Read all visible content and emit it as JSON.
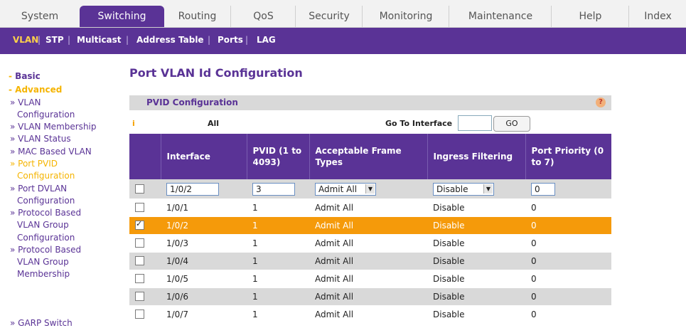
{
  "top_tabs": [
    "System",
    "Switching",
    "Routing",
    "QoS",
    "Security",
    "Monitoring",
    "Maintenance",
    "Help",
    "Index"
  ],
  "top_tab_active": "Switching",
  "sub_tabs": [
    "VLAN",
    "STP",
    "Multicast",
    "Address Table",
    "Ports",
    "LAG"
  ],
  "sub_tab_active": "VLAN",
  "sidebar": {
    "basic": "Basic",
    "advanced": "Advanced",
    "items": [
      "» VLAN",
      "Configuration",
      "» VLAN Membership",
      "» VLAN Status",
      "» MAC Based VLAN",
      "» Port PVID",
      "Configuration",
      "» Port DVLAN",
      "Configuration",
      "» Protocol Based",
      "VLAN Group",
      "Configuration",
      "» Protocol Based",
      "VLAN Group",
      "Membership",
      "» GARP Switch"
    ]
  },
  "page_title": "Port VLAN Id Configuration",
  "panel_title": "PVID Configuration",
  "help_icon": "?",
  "filter": {
    "info_icon": "i",
    "all_label": "All",
    "goto_label": "Go To Interface",
    "goto_value": "",
    "go_button": "GO"
  },
  "columns": [
    "",
    "Interface",
    "PVID (1 to 4093)",
    "Acceptable Frame Types",
    "Ingress Filtering",
    "Port Priority (0 to 7)"
  ],
  "edit_row": {
    "interface": "1/0/2",
    "pvid": "3",
    "frame_types": "Admit All",
    "ingress": "Disable",
    "priority": "0"
  },
  "rows": [
    {
      "interface": "1/0/1",
      "pvid": "1",
      "frame_types": "Admit All",
      "ingress": "Disable",
      "priority": "0",
      "checked": false
    },
    {
      "interface": "1/0/2",
      "pvid": "1",
      "frame_types": "Admit All",
      "ingress": "Disable",
      "priority": "0",
      "checked": true
    },
    {
      "interface": "1/0/3",
      "pvid": "1",
      "frame_types": "Admit All",
      "ingress": "Disable",
      "priority": "0",
      "checked": false
    },
    {
      "interface": "1/0/4",
      "pvid": "1",
      "frame_types": "Admit All",
      "ingress": "Disable",
      "priority": "0",
      "checked": false
    },
    {
      "interface": "1/0/5",
      "pvid": "1",
      "frame_types": "Admit All",
      "ingress": "Disable",
      "priority": "0",
      "checked": false
    },
    {
      "interface": "1/0/6",
      "pvid": "1",
      "frame_types": "Admit All",
      "ingress": "Disable",
      "priority": "0",
      "checked": false
    },
    {
      "interface": "1/0/7",
      "pvid": "1",
      "frame_types": "Admit All",
      "ingress": "Disable",
      "priority": "0",
      "checked": false
    }
  ],
  "colors": {
    "brand_purple": "#5a3396",
    "highlight_orange": "#f59a0a",
    "active_yellow": "#f5b400"
  }
}
